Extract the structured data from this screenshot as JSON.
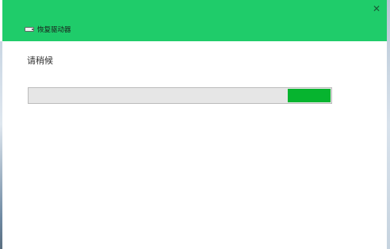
{
  "window": {
    "title": "恢复驱动器",
    "close_glyph": "✕",
    "accent_color": "#1fcc6a"
  },
  "main": {
    "status": "请稍候"
  },
  "progress": {
    "segment_start": 0.855,
    "segment_end": 1.0,
    "fill_color": "#06b42f",
    "track_color": "#e6e6e6"
  },
  "icons": {
    "title_icon": "drive-icon",
    "close_icon": "close-icon"
  }
}
